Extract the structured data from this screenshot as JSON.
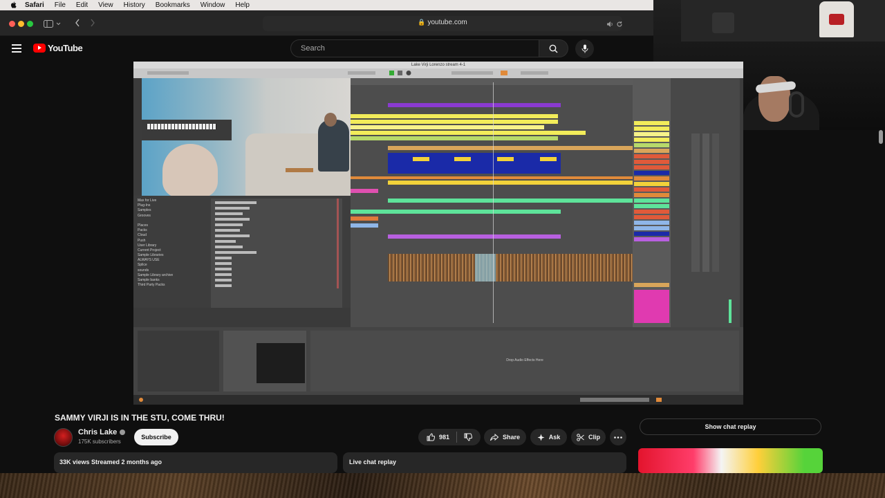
{
  "menubar": {
    "items": [
      "Safari",
      "File",
      "Edit",
      "View",
      "History",
      "Bookmarks",
      "Window",
      "Help"
    ]
  },
  "browser": {
    "url": "youtube.com"
  },
  "youtube": {
    "logo_text": "YouTube",
    "search_placeholder": "Search"
  },
  "video": {
    "daw_title": "Lake Virji Lorenzo stream 4-1",
    "drop_text": "Drop Audio Effects Here"
  },
  "watch": {
    "title": "SAMMY VIRJI IS IN THE STU, COME THRU!",
    "channel_name": "Chris Lake",
    "subscribers": "175K subscribers",
    "subscribe_label": "Subscribe",
    "like_count": "981",
    "share_label": "Share",
    "ask_label": "Ask",
    "clip_label": "Clip",
    "views_meta": "33K views  Streamed 2 months ago",
    "live_chat_label": "Live chat replay",
    "show_chat_label": "Show chat replay"
  },
  "colors": {
    "yt_red": "#ff0000",
    "bg": "#0f0f0f"
  }
}
